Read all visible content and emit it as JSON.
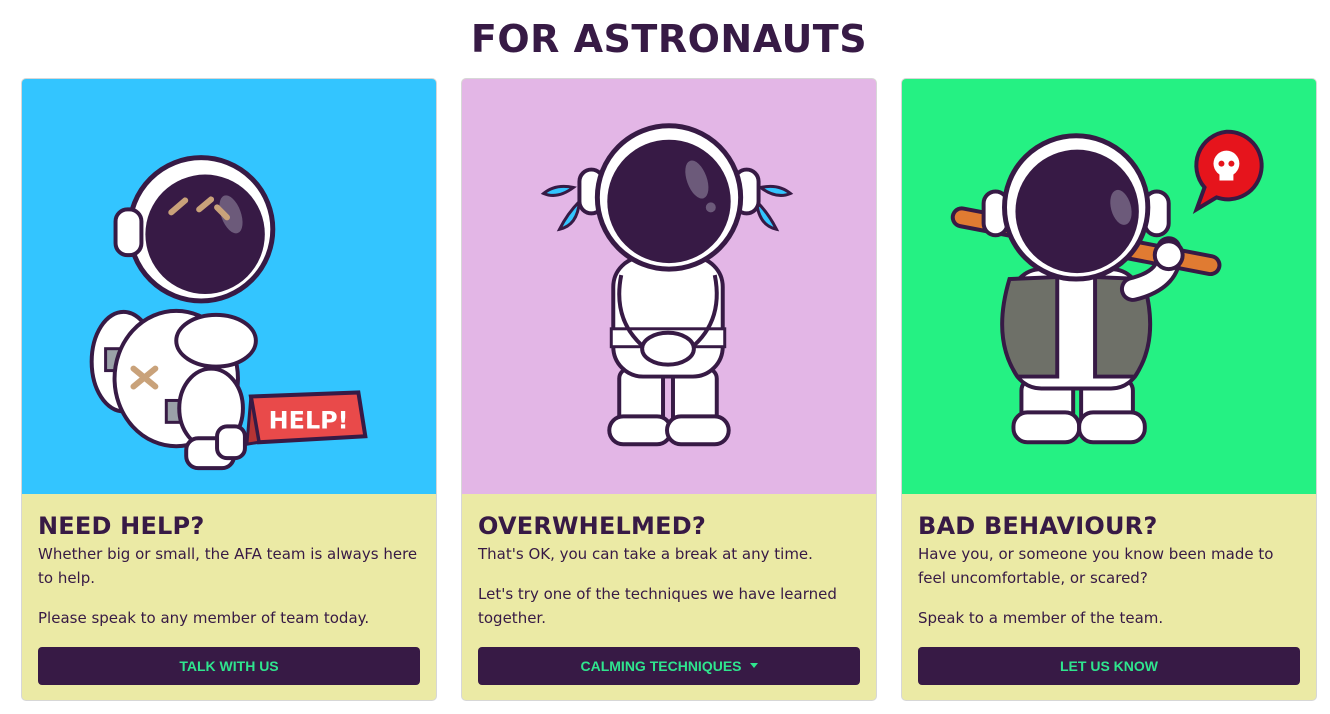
{
  "page": {
    "title": "FOR ASTRONAUTS"
  },
  "colors": {
    "primary": "#371a45",
    "button_text": "#2fe58e",
    "card_body": "#ebeaa5",
    "card1_bg": "#33c5ff",
    "card2_bg": "#e3b6e6",
    "card3_bg": "#25f183"
  },
  "cards": [
    {
      "image": "astronaut-needs-help-illustration",
      "sign": "HELP!",
      "title": "NEED HELP?",
      "paragraphs": [
        "Whether big or small, the AFA team is always here to help.",
        "Please speak to any member of team today."
      ],
      "button": "TALK WITH US"
    },
    {
      "image": "astronaut-crying-illustration",
      "title": "OVERWHELMED?",
      "paragraphs": [
        "That's OK, you can take a break at any time.",
        "Let's try one of the techniques we have learned together."
      ],
      "button": "CALMING TECHNIQUES",
      "button_icon": "caret-down-icon"
    },
    {
      "image": "astronaut-with-bat-illustration",
      "title": "BAD BEHAVIOUR?",
      "paragraphs": [
        "Have you, or someone you know been made to feel uncomfortable, or scared?",
        "Speak to a member of the team."
      ],
      "button": "LET US KNOW"
    }
  ]
}
